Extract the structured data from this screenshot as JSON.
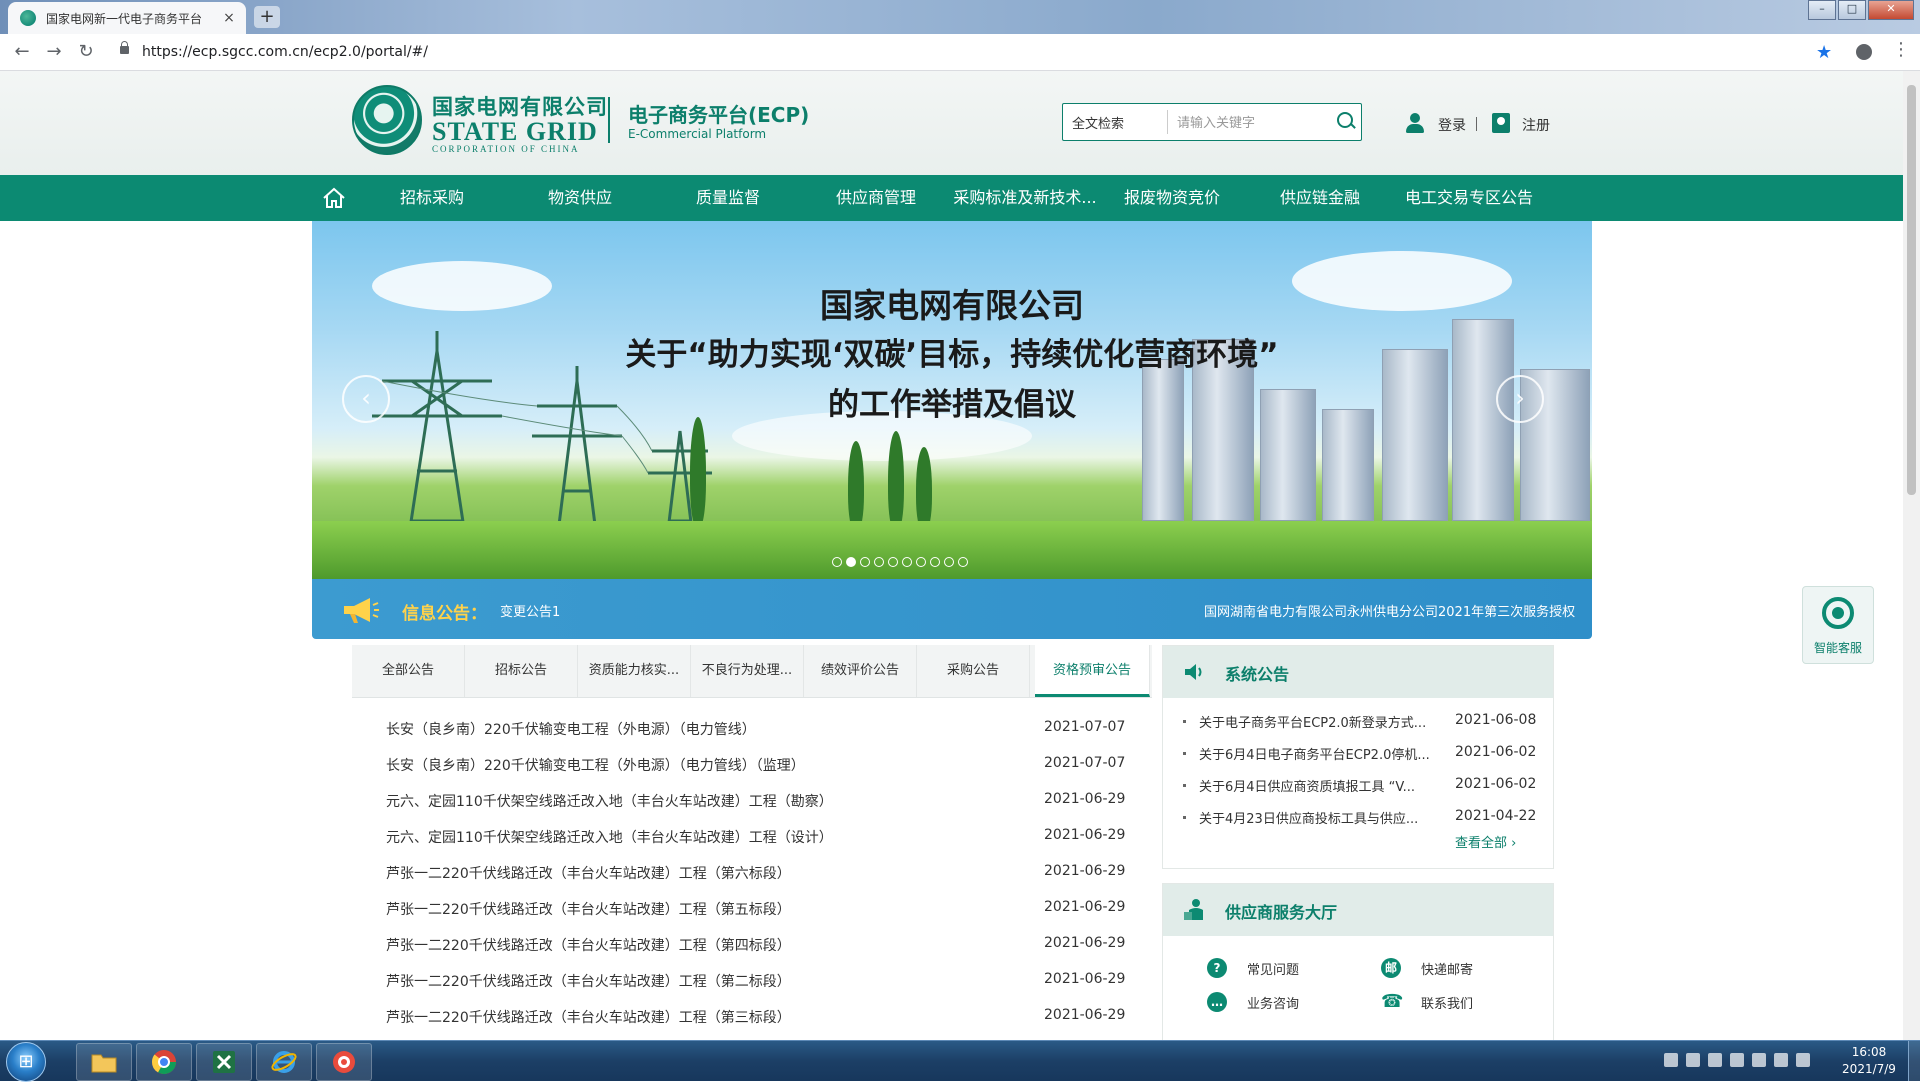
{
  "browser": {
    "tab_title": "国家电网新一代电子商务平台",
    "tab_close": "×",
    "new_tab": "+",
    "url": "https://ecp.sgcc.com.cn/ecp2.0/portal/#/",
    "back": "←",
    "forward": "→",
    "reload": "↻",
    "bookmark_star": "★",
    "menu": "⋮",
    "minimize": "–",
    "maximize": "□",
    "close": "✕"
  },
  "header": {
    "logo_cn": "国家电网有限公司",
    "logo_en": "STATE GRID",
    "logo_en_sub": "CORPORATION OF CHINA",
    "platform_cn": "电子商务平台(ECP)",
    "platform_en": "E-Commercial Platform",
    "search_scope": "全文检索",
    "search_placeholder": "请输入关键字",
    "login": "登录",
    "register": "注册"
  },
  "nav": {
    "items": [
      "招标采购",
      "物资供应",
      "质量监督",
      "供应商管理",
      "采购标准及新技术...",
      "报废物资竞价",
      "供应链金融",
      "电工交易专区公告"
    ]
  },
  "banner": {
    "line1": "国家电网有限公司",
    "line2": "关于“助力实现‘双碳’目标，持续优化营商环境”",
    "line3": "的工作举措及倡议",
    "prev": "‹",
    "next": "›",
    "slide_count": 10,
    "active_slide": 2
  },
  "notice": {
    "title": "信息公告：",
    "subtitle": "变更公告1",
    "marquee": "国网湖南省电力有限公司永州供电分公司2021年第三次服务授权"
  },
  "announcements": {
    "tabs": [
      "全部公告",
      "招标公告",
      "资质能力核实...",
      "不良行为处理...",
      "绩效评价公告",
      "采购公告",
      "资格预审公告"
    ],
    "active_tab": 6,
    "rows": [
      {
        "title": "长安（良乡南）220千伏输变电工程（外电源）（电力管线）",
        "date": "2021-07-07"
      },
      {
        "title": "长安（良乡南）220千伏输变电工程（外电源）（电力管线）（监理）",
        "date": "2021-07-07"
      },
      {
        "title": "元六、定园110千伏架空线路迁改入地（丰台火车站改建）工程（勘察）",
        "date": "2021-06-29"
      },
      {
        "title": "元六、定园110千伏架空线路迁改入地（丰台火车站改建）工程（设计）",
        "date": "2021-06-29"
      },
      {
        "title": "芦张一二220千伏线路迁改（丰台火车站改建）工程（第六标段）",
        "date": "2021-06-29"
      },
      {
        "title": "芦张一二220千伏线路迁改（丰台火车站改建）工程（第五标段）",
        "date": "2021-06-29"
      },
      {
        "title": "芦张一二220千伏线路迁改（丰台火车站改建）工程（第四标段）",
        "date": "2021-06-29"
      },
      {
        "title": "芦张一二220千伏线路迁改（丰台火车站改建）工程（第二标段）",
        "date": "2021-06-29"
      },
      {
        "title": "芦张一二220千伏线路迁改（丰台火车站改建）工程（第三标段）",
        "date": "2021-06-29"
      }
    ]
  },
  "system_notice": {
    "title": "系统公告",
    "rows": [
      {
        "title": "关于电子商务平台ECP2.0新登录方式...",
        "date": "2021-06-08"
      },
      {
        "title": "关于6月4日电子商务平台ECP2.0停机...",
        "date": "2021-06-02"
      },
      {
        "title": "关于6月4日供应商资质填报工具 “V...",
        "date": "2021-06-02"
      },
      {
        "title": "关于4月23日供应商投标工具与供应...",
        "date": "2021-04-22"
      }
    ],
    "view_all": "查看全部 ›"
  },
  "supplier_hall": {
    "title": "供应商服务大厅",
    "items": [
      {
        "label": "常见问题",
        "glyph": "?"
      },
      {
        "label": "快递邮寄",
        "glyph": "邮"
      },
      {
        "label": "业务咨询",
        "glyph": "…"
      },
      {
        "label": "联系我们",
        "glyph": "☎"
      }
    ]
  },
  "smart_service": {
    "label": "智能客服"
  },
  "taskbar": {
    "time": "16:08",
    "date": "2021/7/9"
  },
  "colors": {
    "brand_green": "#0c8a72",
    "notice_blue": "#3c9bd0",
    "notice_title_yellow": "#ffd24a"
  }
}
